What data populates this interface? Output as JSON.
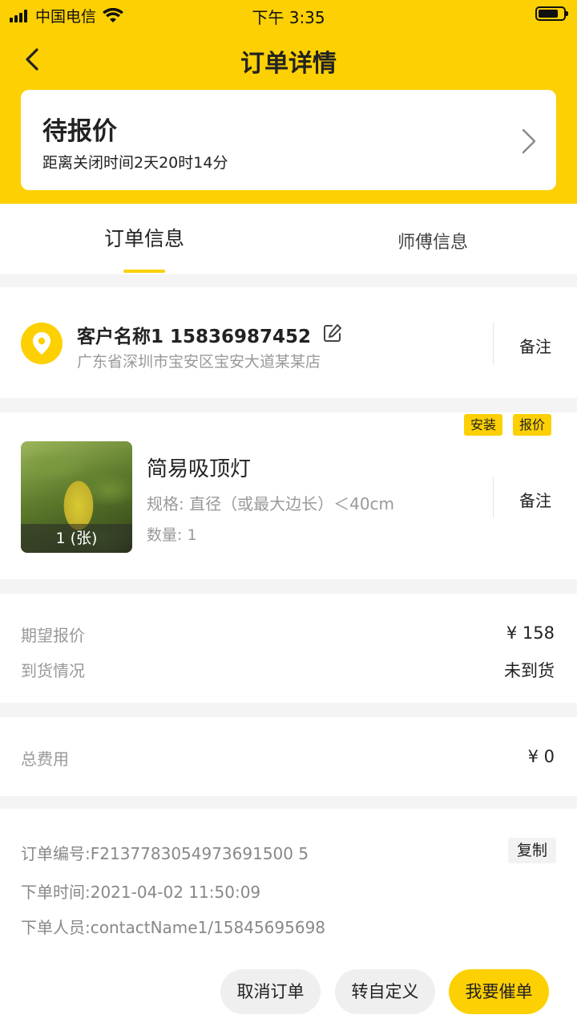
{
  "status_bar": {
    "carrier": "中国电信",
    "time": "下午 3:35"
  },
  "nav": {
    "title": "订单详情"
  },
  "order_status": {
    "title": "待报价",
    "subtitle": "距离关闭时间2天20时14分"
  },
  "tabs": [
    {
      "label": "订单信息",
      "active": true
    },
    {
      "label": "师傅信息",
      "active": false
    }
  ],
  "customer": {
    "name_phone": "客户名称1 15836987452",
    "address": "广东省深圳市宝安区宝安大道某某店",
    "remark_label": "备注"
  },
  "product": {
    "tags": [
      "安装",
      "报价"
    ],
    "name": "简易吸顶灯",
    "spec": "规格: 直径（或最大边长）＜40cm",
    "quantity": "数量: 1",
    "image_caption": "1 (张)",
    "remark_label": "备注"
  },
  "pricing": {
    "expected_price_label": "期望报价",
    "expected_price_value": "¥ 158",
    "arrival_label": "到货情况",
    "arrival_value": "未到货"
  },
  "total": {
    "label": "总费用",
    "value": "¥ 0"
  },
  "order_info": {
    "order_no": "订单编号:F2137783054973691500 5",
    "order_time": "下单时间:2021-04-02 11:50:09",
    "orderer": "下单人员:contactName1/15845695698",
    "copy_label": "复制"
  },
  "actions": {
    "cancel": "取消订单",
    "custom": "转自定义",
    "urge": "我要催单"
  },
  "colors": {
    "accent": "#fcd003",
    "background": "#f4f4f4"
  }
}
